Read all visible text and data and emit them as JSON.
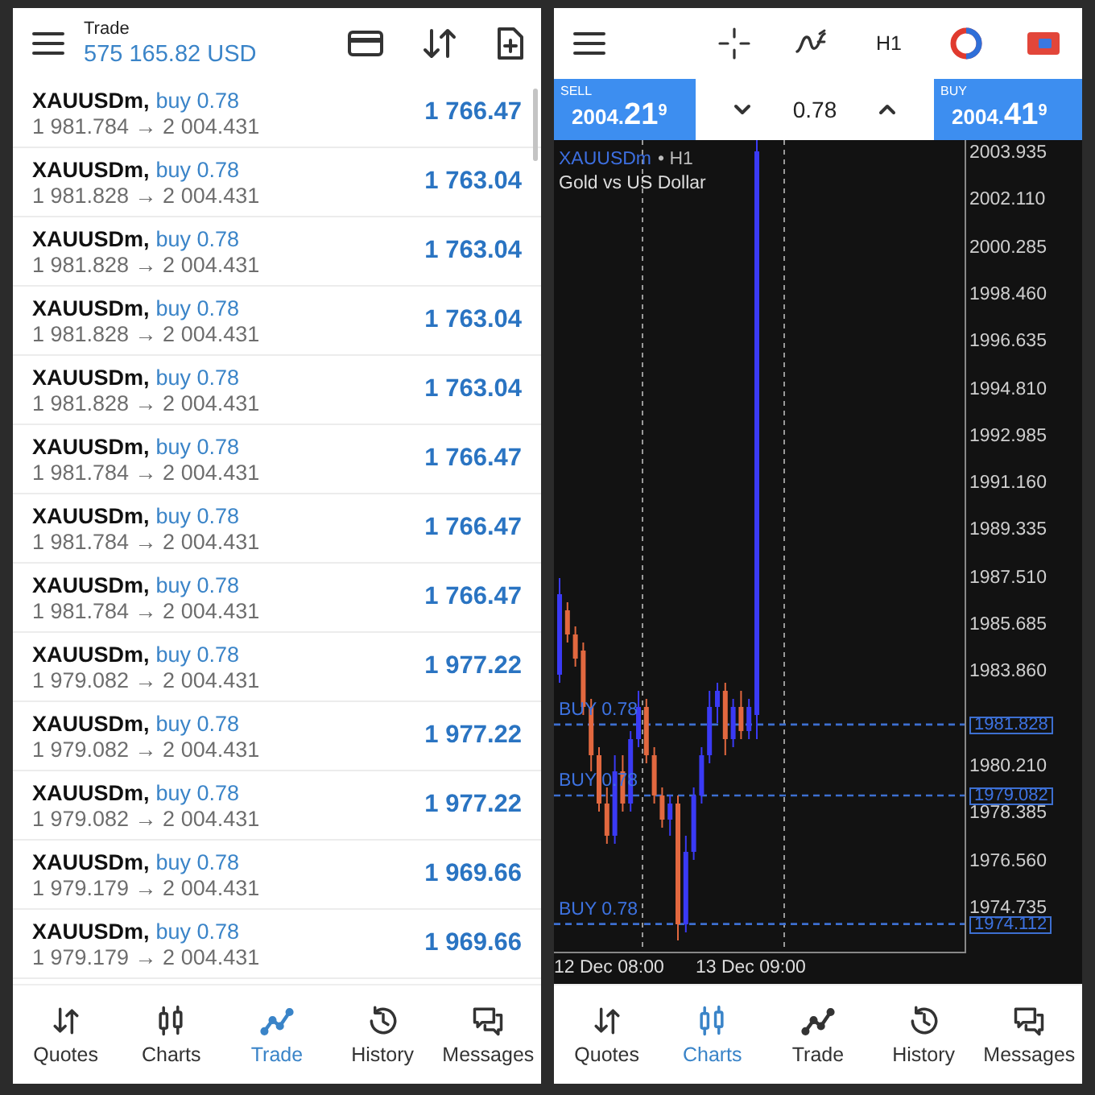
{
  "trade_screen": {
    "title": "Trade",
    "balance": "575 165.82 USD",
    "positions": [
      {
        "symbol": "XAUUSDm,",
        "side": "buy 0.78",
        "prices": "1 981.784 → 2 004.431",
        "profit": "1 766.47"
      },
      {
        "symbol": "XAUUSDm,",
        "side": "buy 0.78",
        "prices": "1 981.828 → 2 004.431",
        "profit": "1 763.04"
      },
      {
        "symbol": "XAUUSDm,",
        "side": "buy 0.78",
        "prices": "1 981.828 → 2 004.431",
        "profit": "1 763.04"
      },
      {
        "symbol": "XAUUSDm,",
        "side": "buy 0.78",
        "prices": "1 981.828 → 2 004.431",
        "profit": "1 763.04"
      },
      {
        "symbol": "XAUUSDm,",
        "side": "buy 0.78",
        "prices": "1 981.828 → 2 004.431",
        "profit": "1 763.04"
      },
      {
        "symbol": "XAUUSDm,",
        "side": "buy 0.78",
        "prices": "1 981.784 → 2 004.431",
        "profit": "1 766.47"
      },
      {
        "symbol": "XAUUSDm,",
        "side": "buy 0.78",
        "prices": "1 981.784 → 2 004.431",
        "profit": "1 766.47"
      },
      {
        "symbol": "XAUUSDm,",
        "side": "buy 0.78",
        "prices": "1 981.784 → 2 004.431",
        "profit": "1 766.47"
      },
      {
        "symbol": "XAUUSDm,",
        "side": "buy 0.78",
        "prices": "1 979.082 → 2 004.431",
        "profit": "1 977.22"
      },
      {
        "symbol": "XAUUSDm,",
        "side": "buy 0.78",
        "prices": "1 979.082 → 2 004.431",
        "profit": "1 977.22"
      },
      {
        "symbol": "XAUUSDm,",
        "side": "buy 0.78",
        "prices": "1 979.082 → 2 004.431",
        "profit": "1 977.22"
      },
      {
        "symbol": "XAUUSDm,",
        "side": "buy 0.78",
        "prices": "1 979.179 → 2 004.431",
        "profit": "1 969.66"
      },
      {
        "symbol": "XAUUSDm,",
        "side": "buy 0.78",
        "prices": "1 979.179 → 2 004.431",
        "profit": "1 969.66"
      }
    ],
    "nav": [
      {
        "label": "Quotes",
        "selected": false
      },
      {
        "label": "Charts",
        "selected": false
      },
      {
        "label": "Trade",
        "selected": true
      },
      {
        "label": "History",
        "selected": false
      },
      {
        "label": "Messages",
        "selected": false
      }
    ]
  },
  "chart_screen": {
    "timeframe": "H1",
    "sell": {
      "label": "SELL",
      "price": "2004.**21**$^{9}$"
    },
    "volume": "0.78",
    "buy": {
      "label": "BUY",
      "price": "2004.**41**$^{9}$"
    },
    "symbol": "XAUUSDm",
    "symbol_timeframe": "• H1",
    "description": "Gold vs US Dollar",
    "price_ticks": [
      "2003.935",
      "2002.110",
      "2000.285",
      "1998.460",
      "1996.635",
      "1994.810",
      "1992.985",
      "1991.160",
      "1989.335",
      "1987.510",
      "1985.685",
      "1983.860",
      "1980.210",
      "1978.385",
      "1976.560",
      "1974.735"
    ],
    "order_lines": [
      {
        "label": "BUY 0.78",
        "price": "1981.828"
      },
      {
        "label": "BUY 0.78",
        "price": "1979.082"
      },
      {
        "label": "BUY 0.78",
        "price": "1974.112"
      }
    ],
    "time_labels": [
      "12 Dec 08:00",
      "13 Dec 09:00"
    ],
    "nav": [
      {
        "label": "Quotes",
        "selected": false
      },
      {
        "label": "Charts",
        "selected": true
      },
      {
        "label": "Trade",
        "selected": false
      },
      {
        "label": "History",
        "selected": false
      },
      {
        "label": "Messages",
        "selected": false
      }
    ]
  }
}
